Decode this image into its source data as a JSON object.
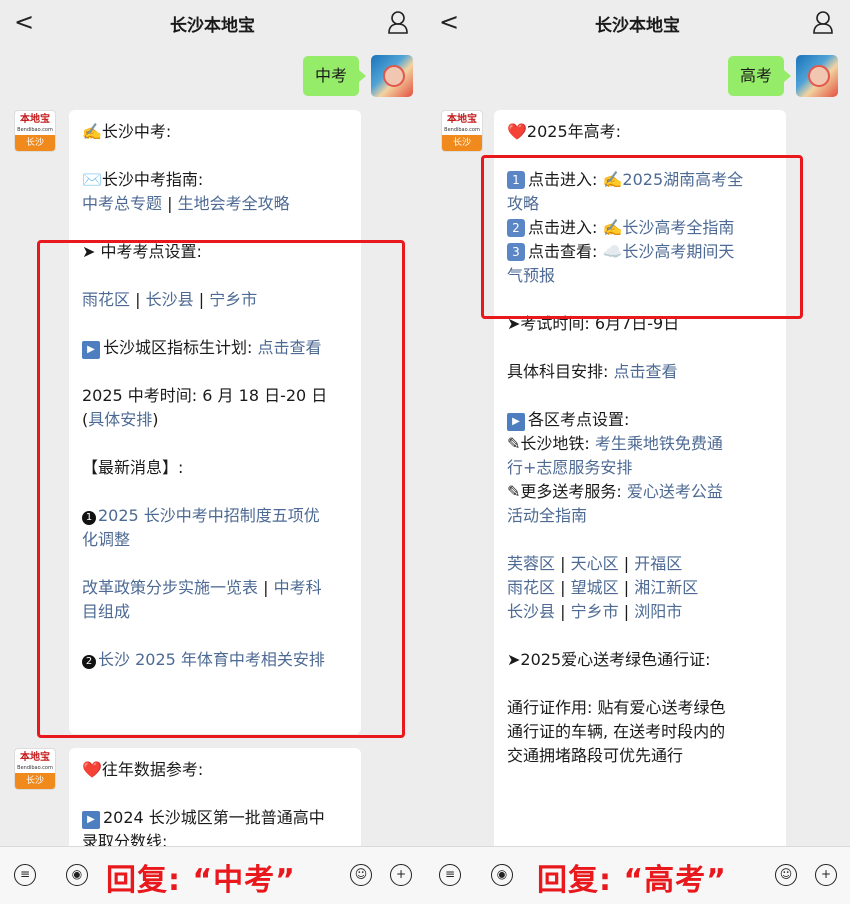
{
  "left": {
    "title": "长沙本地宝",
    "back": "<",
    "sent": "中考",
    "avatar_top": "本地宝",
    "avatar_domain": "Bendibao.com",
    "avatar_city": "长沙",
    "msg1": {
      "l1": "✍️长沙中考:",
      "l2": "✉️长沙中考指南:",
      "l3a": "中考总专题",
      "sep": "|",
      "l3b": "生地会考全攻略",
      "l4": "➤ 中考考点设置:",
      "l5a": "雨花区",
      "l5b": "长沙县",
      "l5c": "宁乡市",
      "l6": "长沙城区指标生计划:",
      "l6link": "点击查看",
      "l7": "2025 中考时间: 6 月 18 日-20 日",
      "l8open": "(",
      "l8link": "具体安排",
      "l8close": ")",
      "l9": "【最新消息】:",
      "n1": "1",
      "l10": "2025 长沙中考中招制度五项优",
      "l11": "化调整",
      "l12a": "改革政策分步实施一览表",
      "l12b": "中考科",
      "l13": "目组成",
      "n2": "2",
      "l14": "长沙 2025 年体育中考相关安排"
    },
    "msg2": {
      "l1": "❤️往年数据参考:",
      "l2": "2024 长沙城区第一批普通高中",
      "l3": "录取分数线:"
    },
    "reply": "回复: “中考”"
  },
  "right": {
    "title": "长沙本地宝",
    "back": "<",
    "sent": "高考",
    "avatar_top": "本地宝",
    "avatar_domain": "Bendibao.com",
    "avatar_city": "长沙",
    "msg1": {
      "l1": "❤️2025年高考:",
      "b1": "1",
      "l2": "点击进入: ✍️",
      "l2link": "2025湖南高考全",
      "l3link": "攻略",
      "b2": "2",
      "l4": "点击进入: ✍️",
      "l4link": "长沙高考全指南",
      "b3": "3",
      "l5": "点击查看: ☁️",
      "l5link": "长沙高考期间天",
      "l6link": "气预报",
      "l7": "➤考试时间: 6月7日-9日",
      "l8": "具体科目安排:",
      "l8link": "点击查看",
      "l9": "各区考点设置:",
      "l10": "✎长沙地铁:",
      "l10link": "考生乘地铁免费通",
      "l11link": "行+志愿服务安排",
      "l12": "✎更多送考服务:",
      "l12link": "爱心送考公益",
      "l13link": "活动全指南",
      "d1": "芙蓉区",
      "d2": "天心区",
      "d3": "开福区",
      "d4": "雨花区",
      "d5": "望城区",
      "d6": "湘江新区",
      "d7": "长沙县",
      "d8": "宁乡市",
      "d9": "浏阳市",
      "sep": "|",
      "l17": "➤2025爱心送考绿色通行证:",
      "l18": "通行证作用: 贴有爱心送考绿色",
      "l19": "通行证的车辆, 在送考时段内的",
      "l20": "交通拥堵路段可优先通行"
    },
    "reply": "回复: “高考”"
  },
  "icons": {
    "menu": "≡",
    "voice": "◉",
    "emoji": "☺",
    "plus": "+"
  },
  "colors": {
    "link": "#4d6a94",
    "highlight_box": "#e8181d",
    "sent_bubble": "#95ec69",
    "avatar_badge": "#f08a1c"
  }
}
